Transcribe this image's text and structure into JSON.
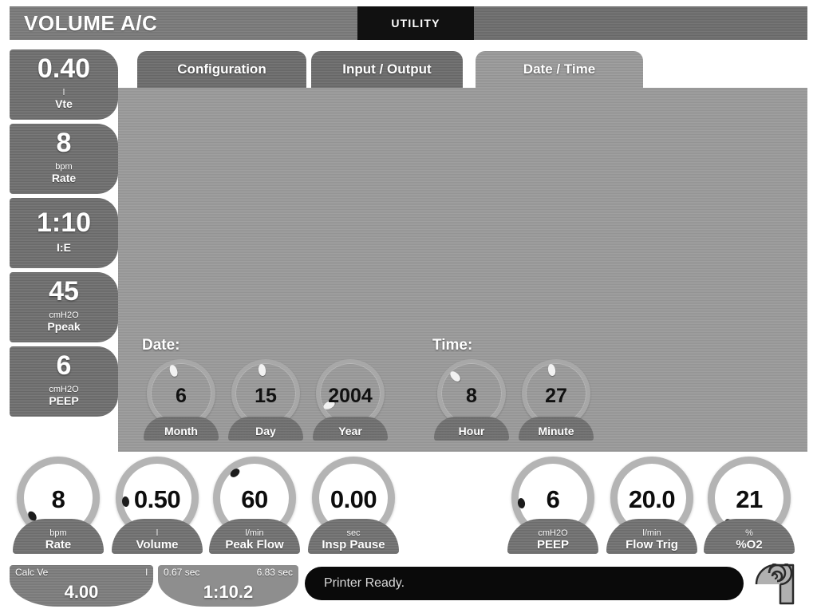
{
  "header": {
    "mode_title": "VOLUME A/C",
    "active_section": "UTILITY"
  },
  "sidebar": {
    "items": [
      {
        "value": "0.40",
        "unit": "l",
        "label": "Vte"
      },
      {
        "value": "8",
        "unit": "bpm",
        "label": "Rate"
      },
      {
        "value": "1:10",
        "unit": "",
        "label": "I:E"
      },
      {
        "value": "45",
        "unit": "cmH2O",
        "label": "Ppeak"
      },
      {
        "value": "6",
        "unit": "cmH2O",
        "label": "PEEP"
      }
    ]
  },
  "tabs": [
    {
      "label": "Configuration",
      "active": false
    },
    {
      "label": "Input / Output",
      "active": false
    },
    {
      "label": "Date / Time",
      "active": true
    }
  ],
  "content": {
    "date_caption": "Date:",
    "time_caption": "Time:",
    "date_dials": [
      {
        "value": "6",
        "label": "Month",
        "pointer_angle": -18
      },
      {
        "value": "15",
        "label": "Day",
        "pointer_angle": -8
      },
      {
        "value": "2004",
        "label": "Year",
        "pointer_angle": -118
      }
    ],
    "time_dials": [
      {
        "value": "8",
        "label": "Hour",
        "pointer_angle": -44
      },
      {
        "value": "27",
        "label": "Minute",
        "pointer_angle": -10
      }
    ]
  },
  "knobs": [
    {
      "value": "8",
      "unit": "bpm",
      "name": "Rate",
      "pointer_angle": -125
    },
    {
      "value": "0.50",
      "unit": "l",
      "name": "Volume",
      "pointer_angle": -96
    },
    {
      "value": "60",
      "unit": "l/min",
      "name": "Peak Flow",
      "pointer_angle": -38
    },
    {
      "value": "0.00",
      "unit": "sec",
      "name": "Insp Pause",
      "pointer_angle": -145
    },
    {
      "value": "6",
      "unit": "cmH2O",
      "name": "PEEP",
      "pointer_angle": -99
    },
    {
      "value": "20.0",
      "unit": "l/min",
      "name": "Flow Trig",
      "pointer_angle": -160
    },
    {
      "value": "21",
      "unit": "%",
      "name": "%O2",
      "pointer_angle": -143
    }
  ],
  "status": {
    "calc_ve_label": "Calc Ve",
    "calc_ve_unit": "l",
    "calc_ve_value": "4.00",
    "ie_insp_time": "0.67 sec",
    "ie_exp_time": "6.83 sec",
    "ie_ratio": "1:10.2",
    "printer_message": "Printer Ready."
  },
  "colors": {
    "panel_gray": "#9a9a9a",
    "tile_gray": "#6f6f6f",
    "active_tab": "#9a9a9a",
    "inactive_tab": "#6c6c6c",
    "black": "#0a0a0a",
    "white": "#ffffff"
  }
}
